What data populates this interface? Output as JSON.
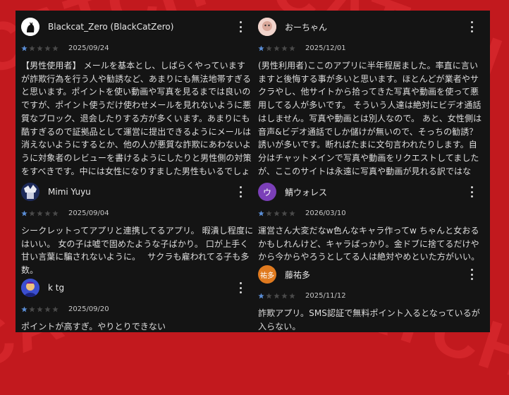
{
  "background_colors": {
    "page": "#c2191e",
    "panel": "#141414",
    "star_filled": "#5b8fd8",
    "star_empty": "#4a4a4a"
  },
  "left_column": [
    {
      "name": "Blackcat_Zero (BlackCatZero)",
      "avatar_icon": "black-cat-icon",
      "rating": 1,
      "date": "2025/09/24",
      "text": "【男性使用者】 メールを基本とし、しばらくやっていますが詐欺行為を行う人や勧誘など、あまりにも無法地帯すぎると思います。ポイントを使い動画や写真を見るまでは良いのですが、ポイント使うだけ使わせメールを見れないように悪質なブロック、退会したりする方が多くいます。あまりにも酷すぎるので証拠品として運営に提出できるようにメールは消えないようにするとか、他の人が悪質な詐欺にあわないように対象者のレビューを書けるようにしたりと男性側の対策をすべきです。中には女性になりすました男性もいるでしょうし問題だらけしかないです。 男性でこのアプリをダウンロー"
    },
    {
      "name": "Mimi Yuyu",
      "avatar_icon": "anime-avatar-icon",
      "rating": 1,
      "date": "2025/09/04",
      "text": "シークレットってアプリと連携してるアプリ。 暇潰し程度にはいい。 女の子は嘘で固めたような子ばかり。 口が上手く甘い言葉に騙されないように。　 サクラも雇われてる子も多数。"
    },
    {
      "name": "k tg",
      "avatar_icon": "blue-character-icon",
      "rating": 1,
      "date": "2025/09/20",
      "text": "ポイントが高すぎ。やりとりできない"
    }
  ],
  "right_column": [
    {
      "name": "おーちゃん",
      "avatar_icon": "photo-avatar-icon",
      "rating": 1,
      "date": "2025/12/01",
      "text": "(男性利用者)ここのアプリに半年程居ました。率直に言いますと後悔する事が多いと思います。ほとんどが業者やサクラやし、他サイトから拾ってきた写真や動画を使って悪用してる人が多いです。 そういう人達は絶対にビデオ通話はしません。写真や動画とは別人なので。 あと、女性側は音声&ビデオ通話でしか儲けが無いので、そっちの勧誘？誘いが多いです。断ればたまに文句言われたりします。自分はチャットメインで写真や動画をリクエストしてましたが、ここのサイトは永遠に写真や動画が見れる訳ではなく、期間が来たら気付いたら見れなくなります。これは女性側から教えて頂きまし"
    },
    {
      "name": "鯖ウォレス",
      "avatar_letter": "ウ",
      "avatar_color": "#7b3fb8",
      "rating": 1,
      "date": "2026/03/10",
      "text": "運営さん大変だなw色んなキャラ作ってw ちゃんと女おるかもしれんけど、キャラばっかり。金ドブに捨てるだけやから今からやろうとしてる人は絶対やめといた方がいい。"
    },
    {
      "name": "藤祐多",
      "avatar_letter": "祐多",
      "avatar_color": "#e07a1f",
      "rating": 1,
      "date": "2025/11/12",
      "text": "詐欺アプリ。SMS認証で無料ポイント入るとなっているが入らない。"
    }
  ]
}
